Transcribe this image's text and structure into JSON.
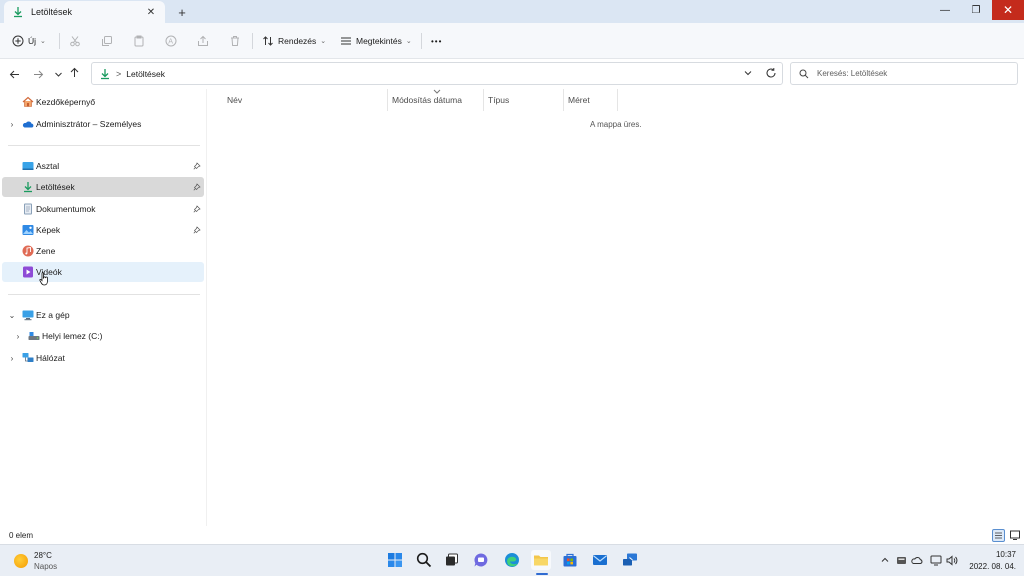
{
  "window": {
    "tab_title": "Letöltések",
    "tab_close_icon": "close-icon",
    "new_tab_symbol": "+",
    "minimize_symbol": "—",
    "maximize_symbol": "❐",
    "close_symbol": "✕"
  },
  "toolbar": {
    "new_label": "Új",
    "sort_label": "Rendezés",
    "view_label": "Megtekintés",
    "more_symbol": "•••",
    "disabled_icons": [
      "cut-icon",
      "copy-icon",
      "paste-icon",
      "rename-icon",
      "share-icon",
      "delete-icon"
    ]
  },
  "address": {
    "location": "Letöltések",
    "separator": ">",
    "search_placeholder": "Keresés: Letöltések"
  },
  "navigation": {
    "items": [
      {
        "label": "Kezdőképernyő",
        "icon": "home-icon"
      },
      {
        "label": "Adminisztrátor – Személyes",
        "icon": "onedrive-icon"
      },
      {
        "label": "Asztal",
        "icon": "desktop-icon",
        "pinned": true
      },
      {
        "label": "Letöltések",
        "icon": "download-icon",
        "pinned": true,
        "selected": true
      },
      {
        "label": "Dokumentumok",
        "icon": "documents-icon",
        "pinned": true
      },
      {
        "label": "Képek",
        "icon": "pictures-icon",
        "pinned": true
      },
      {
        "label": "Zene",
        "icon": "music-icon"
      },
      {
        "label": "Videók",
        "icon": "videos-icon",
        "hovered": true
      },
      {
        "label": "Ez a gép",
        "icon": "this-pc-icon",
        "expanded": true
      },
      {
        "label": "Helyi lemez (C:)",
        "icon": "drive-icon"
      },
      {
        "label": "Hálózat",
        "icon": "network-icon"
      }
    ]
  },
  "content": {
    "columns": [
      "Név",
      "Módosítás dátuma",
      "Típus",
      "Méret"
    ],
    "empty_message": "A mappa üres."
  },
  "status": {
    "item_count": "0 elem"
  },
  "taskbar": {
    "weather_temp": "28°C",
    "weather_condition": "Napos",
    "apps": [
      "start-icon",
      "search-icon",
      "task-view-icon",
      "chat-icon",
      "edge-icon",
      "file-explorer-icon",
      "store-icon",
      "mail-icon",
      "remote-desktop-icon"
    ],
    "time": "10:37",
    "date": "2022. 08. 04."
  },
  "colors": {
    "accent": "#2f6bd1",
    "download_green": "#1a9b5f",
    "close_red": "#c42b1c",
    "folder_yellow": "#f3c64b"
  }
}
